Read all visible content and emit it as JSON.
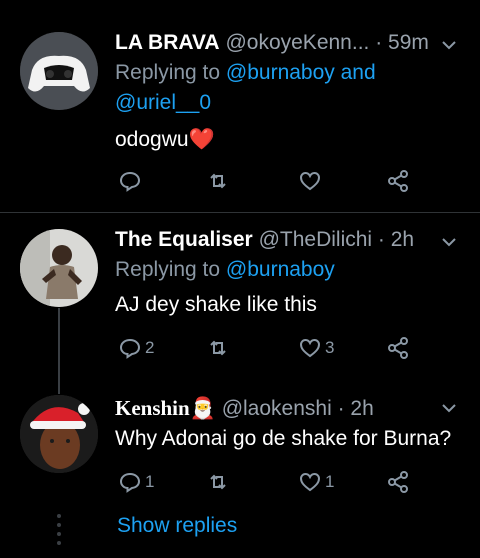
{
  "tweets": [
    {
      "name": "LA BRAVA",
      "handle": "@okoyeKenn...",
      "time": "59m",
      "reply_prefix": "Replying to",
      "reply_line1_link": "@burnaboy and",
      "reply_line2_link": "@uriel__0",
      "text": "odogwu",
      "emoji": "❤️",
      "replies": "",
      "retweets": "",
      "likes": ""
    },
    {
      "name": "The Equaliser",
      "handle": "@TheDilichi",
      "time": "2h",
      "reply_prefix": "Replying to",
      "reply_link": "@burnaboy",
      "text": "AJ dey shake like this",
      "replies": "2",
      "retweets": "",
      "likes": "3"
    },
    {
      "name": "Kenshin",
      "name_emoji": "🎅",
      "handle": "@laokenshi",
      "time": "2h",
      "text": "Why Adonai go de shake for Burna?",
      "replies": "1",
      "retweets": "",
      "likes": "1"
    }
  ],
  "show_replies": "Show replies",
  "colors": {
    "background": "#000000",
    "accent": "#1da1f2",
    "muted": "#8b98a5",
    "heart": "#e0245e"
  },
  "icons": [
    "reply-icon",
    "retweet-icon",
    "like-icon",
    "share-icon",
    "caret-down-icon"
  ]
}
